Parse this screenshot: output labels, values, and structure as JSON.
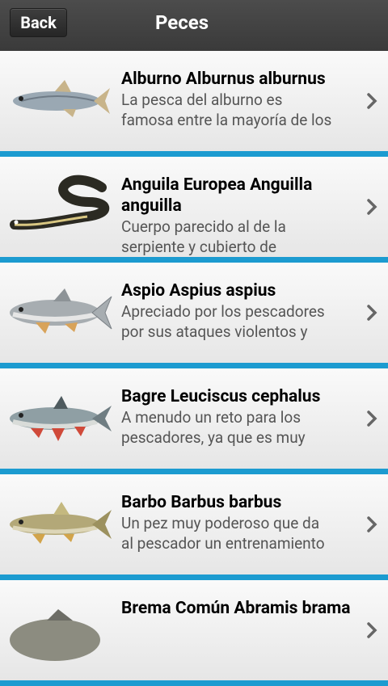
{
  "header": {
    "back_label": "Back",
    "title": "Peces"
  },
  "fish": [
    {
      "name": "Alburno Alburnus alburnus",
      "desc_line1": "La pesca del alburno es",
      "desc_line2": "famosa entre la mayoría de los",
      "body_color": "#9aa8b3",
      "fin_color": "#c8b48a"
    },
    {
      "name": "Anguila Europea Anguilla anguilla",
      "desc_line1": "Cuerpo parecido al de la",
      "desc_line2": "serpiente y cubierto de",
      "body_color": "#2b2a22",
      "fin_color": "#d9c782"
    },
    {
      "name": "Aspio Aspius aspius",
      "desc_line1": "Apreciado por los pescadores",
      "desc_line2": "por sus ataques violentos y",
      "body_color": "#a7adb1",
      "fin_color": "#d8a35a"
    },
    {
      "name": "Bagre Leuciscus cephalus",
      "desc_line1": "A menudo un reto para los",
      "desc_line2": "pescadores, ya que es muy",
      "body_color": "#8f9fa4",
      "fin_color": "#d04a3a"
    },
    {
      "name": "Barbo Barbus barbus",
      "desc_line1": "Un pez muy poderoso que da",
      "desc_line2": "al pescador un entrenamiento",
      "body_color": "#b3a878",
      "fin_color": "#d2a44a"
    },
    {
      "name": "Brema Común Abramis brama",
      "desc_line1": "",
      "desc_line2": "",
      "body_color": "#8c8c80",
      "fin_color": "#6d6d66"
    }
  ]
}
